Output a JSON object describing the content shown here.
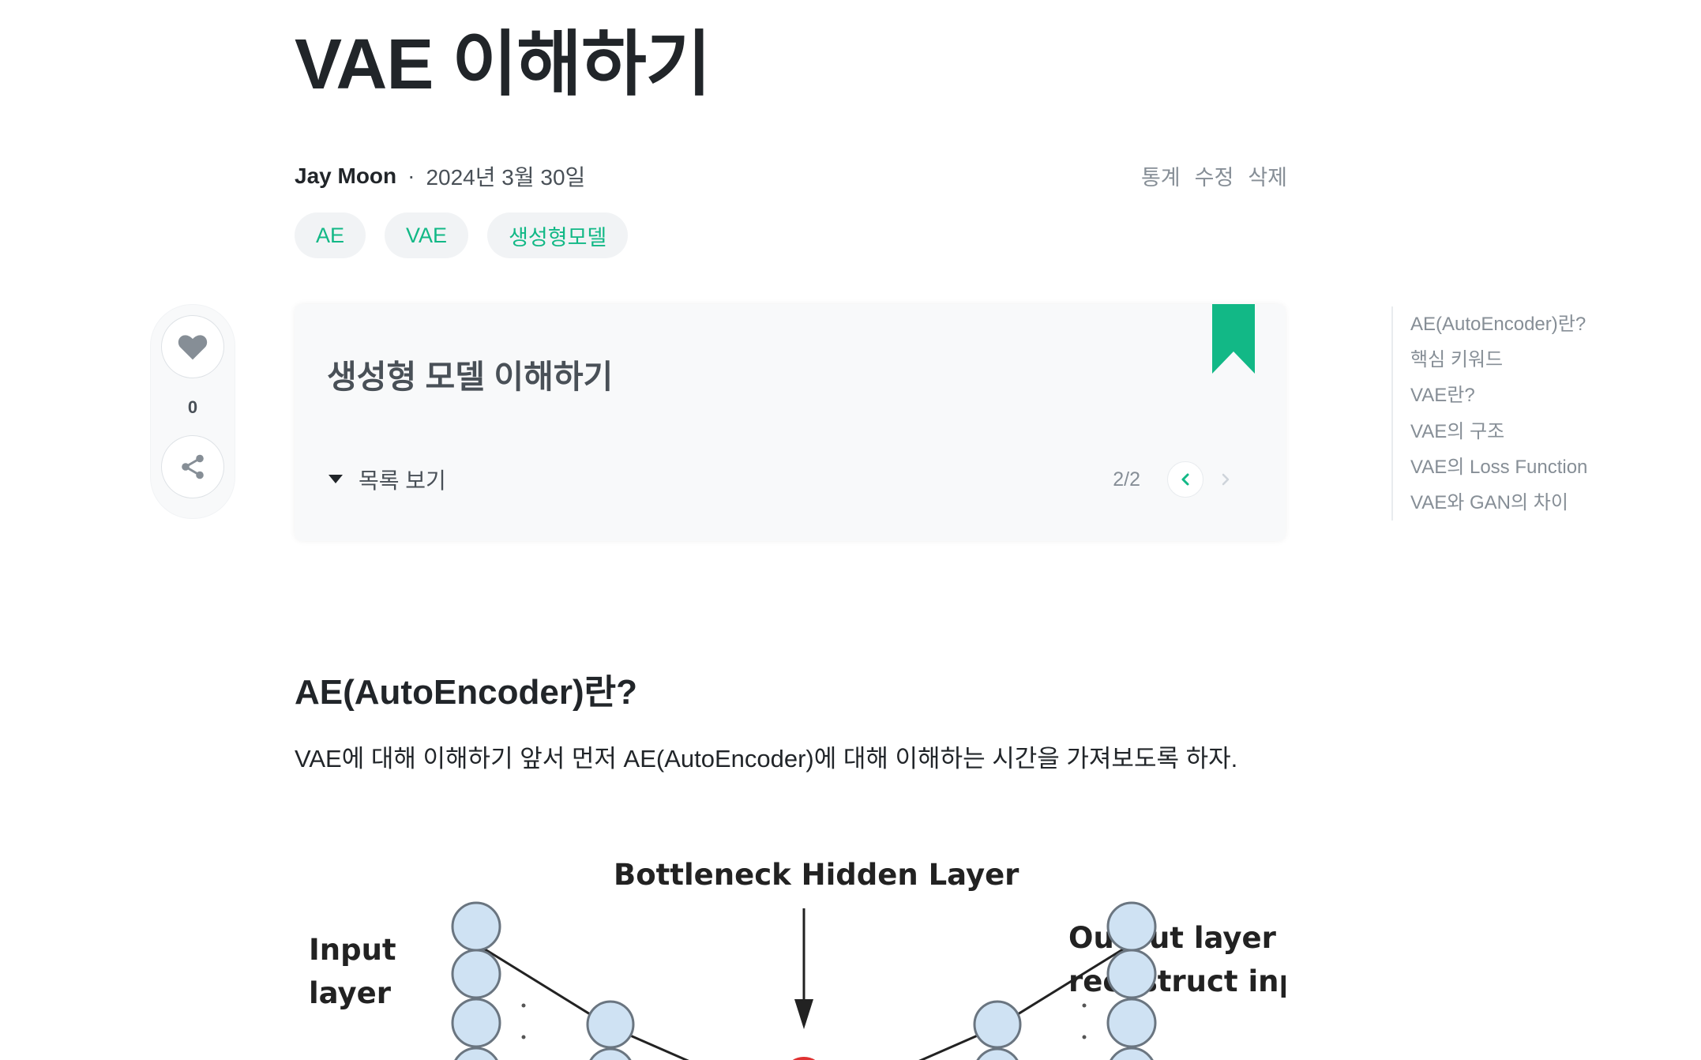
{
  "post": {
    "title": "VAE 이해하기",
    "author": "Jay Moon",
    "separator": "·",
    "date": "2024년 3월 30일",
    "actions": [
      "통계",
      "수정",
      "삭제"
    ],
    "tags": [
      "AE",
      "VAE",
      "생성형모델"
    ]
  },
  "sidebar": {
    "like_count": "0",
    "icons": [
      "heart-icon",
      "share-icon"
    ]
  },
  "series": {
    "title": "생성형 모델 이해하기",
    "toc_toggle_label": "목록 보기",
    "pager": "2/2",
    "accent_color": "#12b886"
  },
  "toc": {
    "items": [
      "AE(AutoEncoder)란?",
      "핵심 키워드",
      "VAE란?",
      "VAE의 구조",
      "VAE의 Loss Function",
      "VAE와 GAN의 차이"
    ]
  },
  "content": {
    "heading": "AE(AutoEncoder)란?",
    "paragraph": "VAE에 대해 이해하기 앞서 먼저 AE(AutoEncoder)에 대해 이해하는 시간을 가져보도록 하자."
  },
  "figure": {
    "bottleneck_label": "Bottleneck Hidden Layer",
    "input_label_line1": "Input",
    "input_label_line2": "layer",
    "output_label_line1": "Output layer",
    "output_label_line2": "recostruct input"
  }
}
